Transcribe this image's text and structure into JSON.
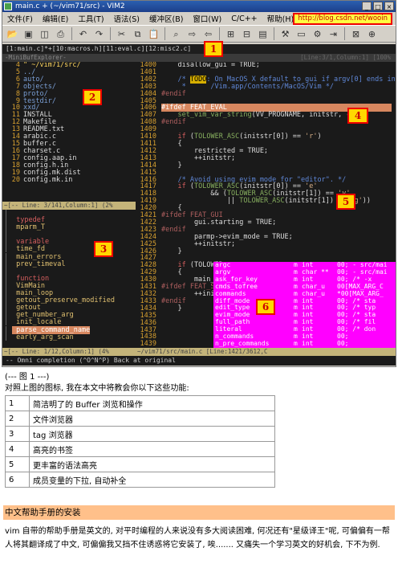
{
  "window": {
    "title": "main.c + (~/vim71/src) - VIM2",
    "url": "http://blog.csdn.net/wooin",
    "menu": [
      "文件(F)",
      "编辑(E)",
      "工具(T)",
      "语法(S)",
      "缓冲区(B)",
      "窗口(W)",
      "C/C++",
      "帮助(H)"
    ],
    "toolbar_icons": [
      "open-icon",
      "save-icon",
      "save-all-icon",
      "print-icon",
      "undo-icon",
      "redo-icon",
      "cut-icon",
      "copy-icon",
      "paste-icon",
      "find-replace-icon",
      "find-next-icon",
      "find-prev-icon",
      "load-session-icon",
      "save-session-icon",
      "run-script-icon",
      "make-icon",
      "shell-icon",
      "run-ctags-icon",
      "tag-jump-icon",
      "help-icon",
      "find-help-icon"
    ],
    "tabline": "[1:main.c]*+[10:macros.h][11:eval.c][12:misc2.c]"
  },
  "minibuf": "-MiniBufExplorer-",
  "explorer": {
    "lines": [
      {
        "n": "4",
        "t": "\" ~/vim71/src/",
        "k": "cur"
      },
      {
        "n": "5",
        "t": "../",
        "k": "dir"
      },
      {
        "n": "6",
        "t": "auto/",
        "k": "dir"
      },
      {
        "n": "7",
        "t": "objects/",
        "k": "dir"
      },
      {
        "n": "8",
        "t": "proto/",
        "k": "dir"
      },
      {
        "n": "9",
        "t": "testdir/",
        "k": "dir"
      },
      {
        "n": "10",
        "t": "xxd/",
        "k": "dir"
      },
      {
        "n": "11",
        "t": "INSTALL",
        "k": "file"
      },
      {
        "n": "12",
        "t": "Makefile",
        "k": "file"
      },
      {
        "n": "13",
        "t": "README.txt",
        "k": "file"
      },
      {
        "n": "14",
        "t": "arabic.c",
        "k": "file"
      },
      {
        "n": "15",
        "t": "buffer.c",
        "k": "file"
      },
      {
        "n": "16",
        "t": "charset.c",
        "k": "file"
      },
      {
        "n": "17",
        "t": "config.aap.in",
        "k": "file"
      },
      {
        "n": "18",
        "t": "config.h.in",
        "k": "file"
      },
      {
        "n": "19",
        "t": "config.mk.dist",
        "k": "file"
      },
      {
        "n": "20",
        "t": "config.mk.in",
        "k": "file"
      }
    ],
    "status": "~[-- Line: 3/141,Column:1] (2%"
  },
  "taglist": {
    "lines": [
      {
        "t": "",
        "k": "tv"
      },
      {
        "t": "  typedef",
        "k": "tk"
      },
      {
        "t": "    mparm_T",
        "k": "tv"
      },
      {
        "t": "",
        "k": "tv"
      },
      {
        "t": "  variable",
        "k": "tk"
      },
      {
        "t": "    time_fd",
        "k": "tv"
      },
      {
        "t": "    main_errors",
        "k": "tv"
      },
      {
        "t": "    prev_timeval",
        "k": "tv"
      },
      {
        "t": "",
        "k": "tv"
      },
      {
        "t": "  function",
        "k": "tk"
      },
      {
        "t": "    VimMain",
        "k": "tv"
      },
      {
        "t": "    main_loop",
        "k": "tv"
      },
      {
        "t": "    getout_preserve_modified",
        "k": "tv"
      },
      {
        "t": "    getout",
        "k": "tv"
      },
      {
        "t": "    get_number_arg",
        "k": "tv"
      },
      {
        "t": "    init_locale",
        "k": "tv"
      },
      {
        "t": "    parse_command_name",
        "k": "sel"
      },
      {
        "t": "    early_arg_scan",
        "k": "tv"
      }
    ],
    "status": "~[-- Line: 1/12,Column:1] (4%",
    "status_right": "~/vim71/src/main.c [Line:1421/3612,C"
  },
  "code": {
    "header": "[Line:3/1,Column:1] [100%",
    "lines": [
      {
        "n": "1400",
        "h": "    disallow_gui = TRUE;"
      },
      {
        "n": "1401",
        "h": ""
      },
      {
        "n": "1402",
        "h": "<span class='cm'>    /* <span class='td'>TODO</span>: On MacOS X default to gui if argv[0] ends in:</span>"
      },
      {
        "n": "1403",
        "h": "<span class='cm'>     *      /Vim.app/Contents/MacOS/Vim */</span>"
      },
      {
        "n": "1404",
        "h": "<span class='pp'>#endif</span>"
      },
      {
        "n": "1405",
        "h": ""
      },
      {
        "n": "1406",
        "h": "<span class='hl'>#ifdef FEAT_EVAL                                        </span>"
      },
      {
        "n": "1407",
        "h": "    <span class='fn'>set_vim_var_string</span>(VV_PROGNAME, initstr, -1);"
      },
      {
        "n": "1408",
        "h": "<span class='pp'>#endif</span>"
      },
      {
        "n": "1409",
        "h": ""
      },
      {
        "n": "1410",
        "h": "    <span class='kw'>if</span> (<span class='fn'>TOLOWER_ASC</span>(initstr[0]) == <span class='str'>'r'</span>)"
      },
      {
        "n": "1411",
        "h": "    {"
      },
      {
        "n": "1412",
        "h": "        restricted = TRUE;"
      },
      {
        "n": "1413",
        "h": "        ++initstr;"
      },
      {
        "n": "1414",
        "h": "    }"
      },
      {
        "n": "1415",
        "h": ""
      },
      {
        "n": "1416",
        "h": "<span class='cm'>    /* Avoid using evim mode for \"editor\". */</span>"
      },
      {
        "n": "1417",
        "h": "    <span class='kw'>if</span> (<span class='fn'>TOLOWER_ASC</span>(initstr[0]) == <span class='str'>'e'</span>"
      },
      {
        "n": "1418",
        "h": "            &amp;&amp; (<span class='fn'>TOLOWER_ASC</span>(initstr[1]) == <span class='str'>'v'</span>"
      },
      {
        "n": "1419",
        "h": "                || <span class='fn'>TOLOWER_ASC</span>(initstr[1]) == <span class='str'>'g'</span>))"
      },
      {
        "n": "1420",
        "h": "    {"
      },
      {
        "n": "1421",
        "h": "<span class='pp'>#ifdef FEAT_GUI</span>"
      },
      {
        "n": "1422",
        "h": "        gui.starting = TRUE;"
      },
      {
        "n": "1423",
        "h": "<span class='pp'>#endif</span>"
      },
      {
        "n": "1424",
        "h": "        parmp-&gt;evim_mode = TRUE;"
      },
      {
        "n": "1425",
        "h": "        ++initstr;"
      },
      {
        "n": "1426",
        "h": "    }"
      },
      {
        "n": "1427",
        "h": ""
      },
      {
        "n": "1428",
        "h": "    <span class='kw'>if</span> (TOLOWER_"
      },
      {
        "n": "1429",
        "h": "    {"
      },
      {
        "n": "1430",
        "h": "        main_s"
      },
      {
        "n": "1431",
        "h": "<span class='pp'>#ifdef FEAT_SUN</span>"
      },
      {
        "n": "1432",
        "h": "        ++initst"
      },
      {
        "n": "1433",
        "h": "<span class='pp'>#endif</span>"
      },
      {
        "n": "1434",
        "h": "    }"
      },
      {
        "n": "1435",
        "h": ""
      },
      {
        "n": "1436",
        "h": ""
      },
      {
        "n": "1437",
        "h": ""
      },
      {
        "n": "1438",
        "h": ""
      },
      {
        "n": "1439",
        "h": ""
      }
    ]
  },
  "popup": [
    {
      "a": "argc",
      "b": "m",
      "c": "int",
      "d": "00; - src/mai"
    },
    {
      "a": "argv",
      "b": "m",
      "c": "char  **",
      "d": "00; - src/mai"
    },
    {
      "a": "ask_for_key",
      "b": "m",
      "c": "int",
      "d": "00;  /* -x"
    },
    {
      "a": "cmds_tofree",
      "b": "m",
      "c": "char_u",
      "d": "00[MAX_ARG_C"
    },
    {
      "a": "commands",
      "b": "m",
      "c": "char_u",
      "d": "*00[MAX_ARG_"
    },
    {
      "a": "diff_mode",
      "b": "m",
      "c": "int",
      "d": "00;  /* sta"
    },
    {
      "a": "edit_type",
      "b": "m",
      "c": "int",
      "d": "00;  /* typ"
    },
    {
      "a": "evim_mode",
      "b": "m",
      "c": "int",
      "d": "00;  /* sta"
    },
    {
      "a": "full_path",
      "b": "m",
      "c": "int",
      "d": "00;  /* fil"
    },
    {
      "a": "literal",
      "b": "m",
      "c": "int",
      "d": "00;  /* don"
    },
    {
      "a": "n_commands",
      "b": "m",
      "c": "int",
      "d": "00;"
    },
    {
      "a": "n_pre_commands",
      "b": "m",
      "c": "int",
      "d": "00;"
    }
  ],
  "cmdline": "-- Omni completion (^O^N^P) Back at original",
  "badges": [
    "1",
    "2",
    "3",
    "4",
    "5",
    "6"
  ],
  "article": {
    "caption": "(--- 图 1 ---)",
    "intro": "对照上图的图标, 我在本文中将教会你以下这些功能:",
    "features": [
      {
        "n": "1",
        "t": "简洁明了的 Buffer 浏览和操作"
      },
      {
        "n": "2",
        "t": "文件浏览器"
      },
      {
        "n": "3",
        "t": "tag 浏览器"
      },
      {
        "n": "4",
        "t": "高亮的书签"
      },
      {
        "n": "5",
        "t": "更丰富的语法高亮"
      },
      {
        "n": "6",
        "t": "成员变量的下拉, 自动补全"
      }
    ],
    "section_title": "中文帮助手册的安装",
    "paragraph": "vim 自带的帮助手册是英文的, 对平时编程的人来说没有多大阅读困难, 何况还有\"星级译王\"呢, 可偏偏有一帮人将其翻译成了中文, 可偏偏我又挡不住诱惑将它安装了, 唉....... 又痛失一个学习英文的好机会, 下不为例."
  }
}
